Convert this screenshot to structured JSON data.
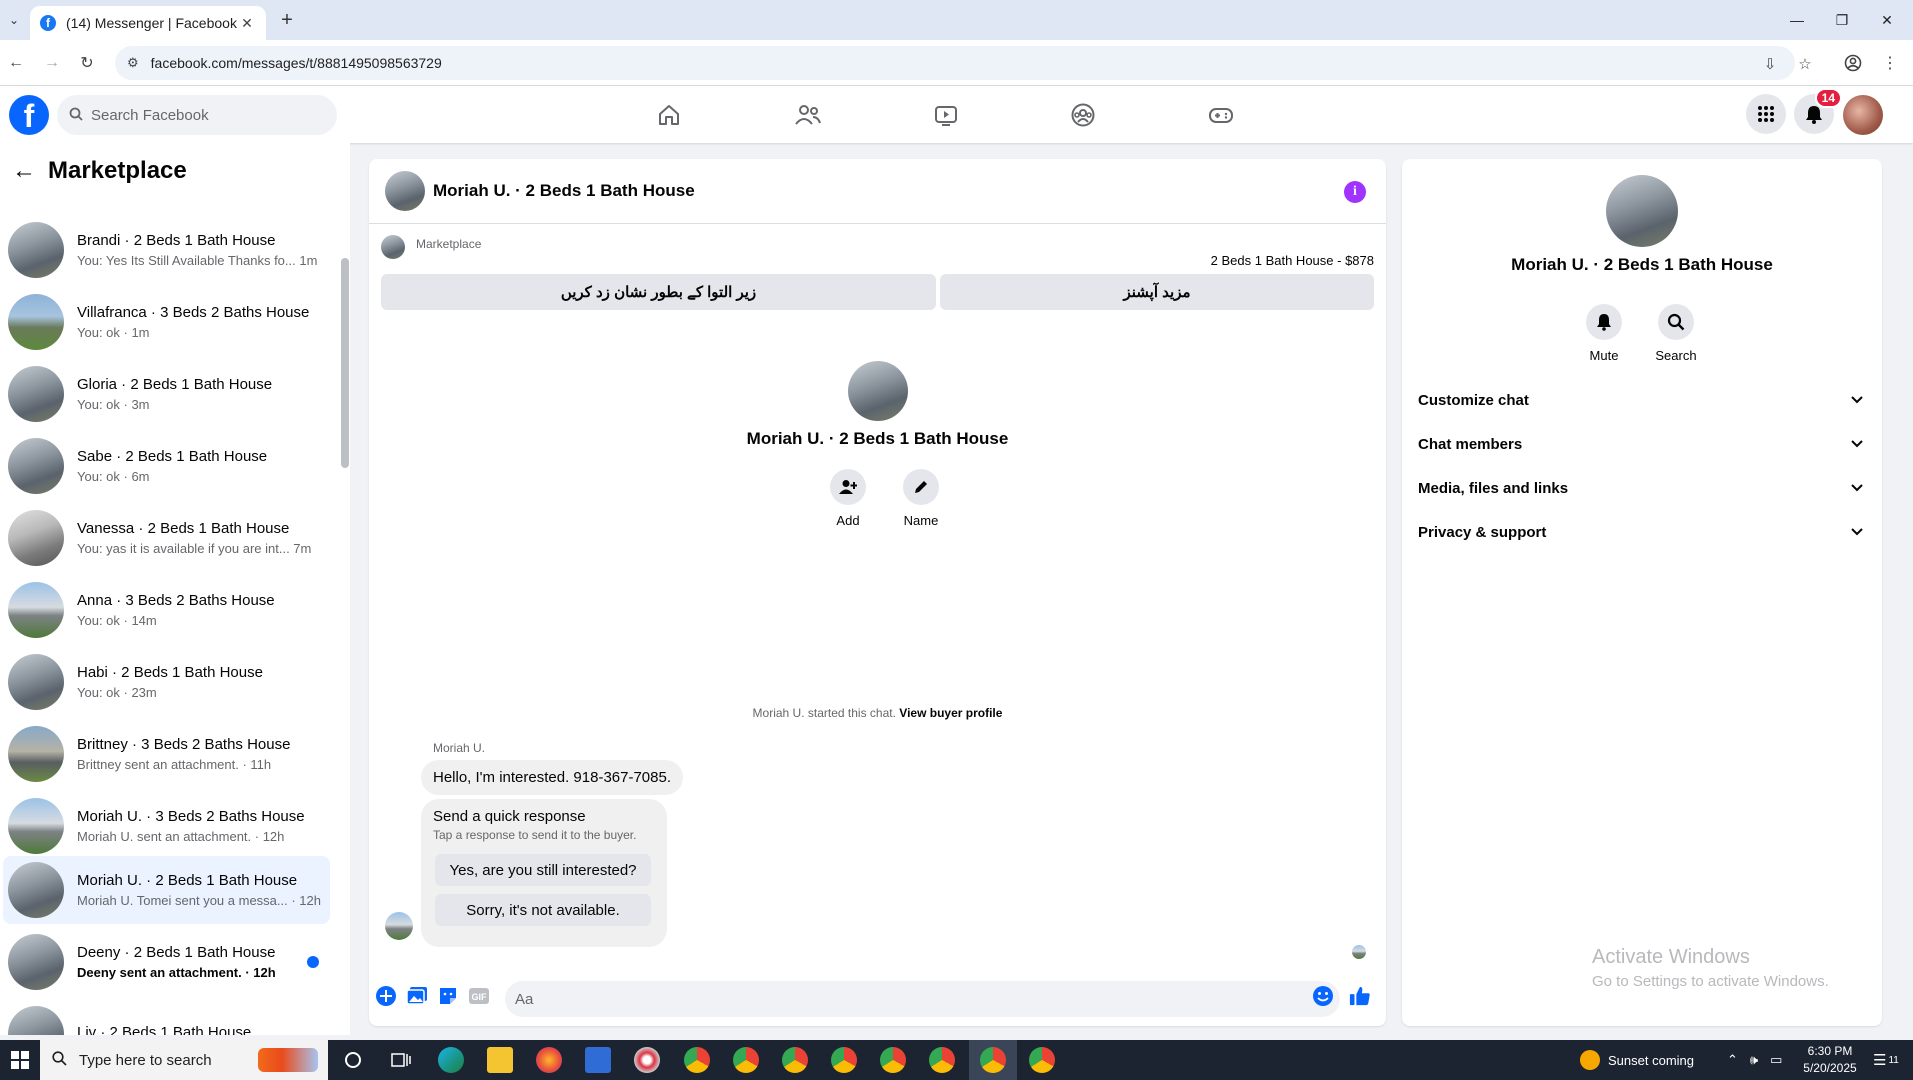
{
  "browser": {
    "tab_title": "(14) Messenger | Facebook",
    "url": "facebook.com/messages/t/8881495098563729"
  },
  "header": {
    "search_placeholder": "Search Facebook",
    "notification_count": "14"
  },
  "sidebar": {
    "title": "Marketplace",
    "conversations": [
      {
        "name": "Brandi · 2 Beds 1 Bath House",
        "preview": "You: Yes Its Still Available Thanks fo... 1m",
        "unread": false,
        "active": false
      },
      {
        "name": "Villafranca · 3 Beds 2 Baths House",
        "preview": "You: ok · 1m",
        "unread": false,
        "active": false
      },
      {
        "name": "Gloria · 2 Beds 1 Bath House",
        "preview": "You: ok · 3m",
        "unread": false,
        "active": false
      },
      {
        "name": "Sabe · 2 Beds 1 Bath House",
        "preview": "You: ok · 6m",
        "unread": false,
        "active": false
      },
      {
        "name": "Vanessa · 2 Beds 1 Bath House",
        "preview": "You: yas it is available if you are int... 7m",
        "unread": false,
        "active": false
      },
      {
        "name": "Anna · 3 Beds 2 Baths House",
        "preview": "You: ok · 14m",
        "unread": false,
        "active": false
      },
      {
        "name": "Habi · 2 Beds 1 Bath House",
        "preview": "You: ok · 23m",
        "unread": false,
        "active": false
      },
      {
        "name": "Brittney · 3 Beds 2 Baths House",
        "preview": "Brittney sent an attachment. · 11h",
        "unread": false,
        "active": false
      },
      {
        "name": "Moriah U. · 3 Beds 2 Baths House",
        "preview": "Moriah U. sent an attachment. · 12h",
        "unread": false,
        "active": false
      },
      {
        "name": "Moriah U. · 2 Beds 1 Bath House",
        "preview": "Moriah U. Tomei sent you a messa... · 12h",
        "unread": false,
        "active": true
      },
      {
        "name": "Deeny · 2 Beds 1 Bath House",
        "preview": "Deeny sent an attachment. · 12h",
        "unread": true,
        "active": false
      },
      {
        "name": "Liv · 2 Beds 1 Bath House",
        "preview": "",
        "unread": false,
        "active": false
      }
    ]
  },
  "chat": {
    "title": "Moriah U. · 2 Beds 1 Bath House",
    "marketplace_label": "Marketplace",
    "listing": "2 Beds 1 Bath House - $878",
    "btn_mark_pending": "زیر التوا کے بطور نشان زد کریں",
    "btn_more_options": "مزید آپشنز",
    "center_name": "Moriah U. · 2 Beds 1 Bath House",
    "action_add": "Add",
    "action_name": "Name",
    "started_text": "Moriah U. started this chat.",
    "view_profile": "View buyer profile",
    "sender_name": "Moriah U.",
    "message": "Hello, I'm interested. 918-367-7085.",
    "quick_response_title": "Send a quick response",
    "quick_response_sub": "Tap a response to send it to the buyer.",
    "quick_1": "Yes, are you still interested?",
    "quick_2": "Sorry, it's not available.",
    "input_placeholder": "Aa",
    "gif_label": "GIF"
  },
  "right_panel": {
    "name": "Moriah U. · 2 Beds 1 Bath House",
    "mute": "Mute",
    "search": "Search",
    "sections": [
      "Customize chat",
      "Chat members",
      "Media, files and links",
      "Privacy & support"
    ]
  },
  "watermark": {
    "line1": "Activate Windows",
    "line2": "Go to Settings to activate Windows."
  },
  "taskbar": {
    "search_placeholder": "Type here to search",
    "weather": "Sunset coming",
    "time": "6:30 PM",
    "date": "5/20/2025",
    "notif_count": "11"
  },
  "colors": {
    "fb_blue": "#0866ff",
    "active_conv_bg": "#eaf3ff",
    "info_purple": "#a033ff",
    "badge_red": "#e41e3f"
  }
}
